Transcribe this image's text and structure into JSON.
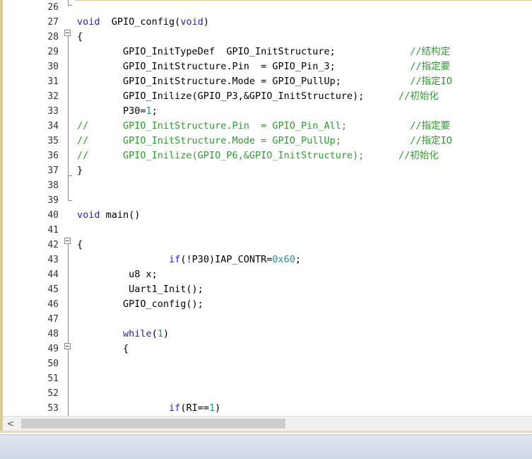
{
  "editor": {
    "lines": [
      {
        "n": "26",
        "code": ""
      },
      {
        "n": "27",
        "code": "<span class='kw'>void</span>  GPIO_config(<span class='kw'>void</span>)"
      },
      {
        "n": "28",
        "code": "{"
      },
      {
        "n": "29",
        "code": "        GPIO_InitTypeDef  GPIO_InitStructure;             <span class='cm'>//结构定</span>"
      },
      {
        "n": "30",
        "code": "        GPIO_InitStructure.Pin  = GPIO_Pin_3;             <span class='cm'>//指定要</span>"
      },
      {
        "n": "31",
        "code": "        GPIO_InitStructure.Mode = GPIO_PullUp;            <span class='cm'>//指定IO</span>"
      },
      {
        "n": "32",
        "code": "        GPIO_Inilize(GPIO_P3,&amp;GPIO_InitStructure);      <span class='cm'>//初始化</span>"
      },
      {
        "n": "33",
        "code": "        P30=<span class='num'>1</span>;"
      },
      {
        "n": "34",
        "code": "<span class='cm'>//      GPIO_InitStructure.Pin  = GPIO_Pin_All;           //指定要</span>"
      },
      {
        "n": "35",
        "code": "<span class='cm'>//      GPIO_InitStructure.Mode = GPIO_PullUp;            //指定IO</span>"
      },
      {
        "n": "36",
        "code": "<span class='cm'>//      GPIO_Inilize(GPIO_P6,&amp;GPIO_InitStructure);      //初始化</span>"
      },
      {
        "n": "37",
        "code": "}"
      },
      {
        "n": "38",
        "code": ""
      },
      {
        "n": "39",
        "code": ""
      },
      {
        "n": "40",
        "code": "<span class='kw'>void</span> main()"
      },
      {
        "n": "41",
        "code": ""
      },
      {
        "n": "42",
        "code": "{"
      },
      {
        "n": "43",
        "code": "                <span class='kw'>if</span>(!P30)IAP_CONTR=<span class='num'>0x60</span>;"
      },
      {
        "n": "44",
        "code": "         u8 x;"
      },
      {
        "n": "45",
        "code": "         Uart1_Init();"
      },
      {
        "n": "46",
        "code": "        GPIO_config();"
      },
      {
        "n": "47",
        "code": ""
      },
      {
        "n": "48",
        "code": "        <span class='kw'>while</span>(<span class='num'>1</span>)"
      },
      {
        "n": "49",
        "code": "        {"
      },
      {
        "n": "50",
        "code": ""
      },
      {
        "n": "51",
        "code": ""
      },
      {
        "n": "52",
        "code": ""
      },
      {
        "n": "53",
        "code": "                <span class='kw'>if</span>(RI==<span class='num'>1</span>)"
      }
    ]
  },
  "scrollbar": {
    "left_arrow": "<"
  }
}
